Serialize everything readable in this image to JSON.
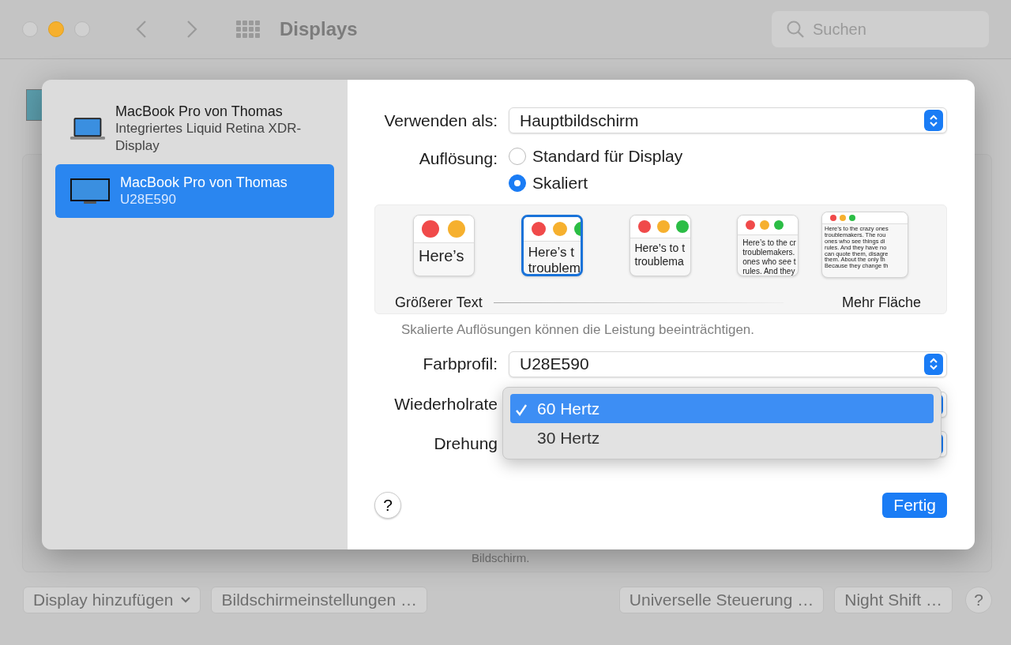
{
  "window": {
    "title": "Displays",
    "search": {
      "placeholder": "Suchen"
    }
  },
  "background": {
    "hidden_text": "Bildschirm.",
    "buttons": [
      {
        "label": "Display hinzufügen",
        "kind": "dropdown"
      },
      {
        "label": "Bildschirmeinstellungen …",
        "kind": "plain"
      },
      {
        "label": "Universelle Steuerung …",
        "kind": "plain"
      },
      {
        "label": "Night Shift …",
        "kind": "plain"
      }
    ],
    "help": "?"
  },
  "sheet": {
    "sidebar": {
      "items": [
        {
          "name": "MacBook Pro von Thomas",
          "detail": "Integriertes Liquid Retina XDR-Display",
          "kind": "laptop",
          "selected": false
        },
        {
          "name": "MacBook Pro von Thomas",
          "detail": "U28E590",
          "kind": "monitor",
          "selected": true
        }
      ]
    },
    "use_as": {
      "label": "Verwenden als:",
      "value": "Hauptbildschirm"
    },
    "resolution": {
      "label": "Auflösung:",
      "options": [
        {
          "label": "Standard für Display",
          "selected": false
        },
        {
          "label": "Skaliert",
          "selected": true
        }
      ]
    },
    "scaling": {
      "previews": [
        {
          "lines": [
            "Here’s"
          ],
          "selected": false
        },
        {
          "lines": [
            "Here’s t",
            "troublem"
          ],
          "selected": true
        },
        {
          "lines": [
            "Here’s to t",
            "troublema"
          ],
          "selected": false
        },
        {
          "lines": [
            "Here’s to the cr",
            "troublemakers.",
            "ones who see t",
            "rules. And they"
          ],
          "selected": false
        },
        {
          "lines": [
            "Here’s to the crazy ones",
            "troublemakers. The rou",
            "ones who see things di",
            "rules. And they have no",
            "can quote them, disagre",
            "them. About the only th",
            "Because they change th"
          ],
          "selected": false
        }
      ],
      "left_label": "Größerer Text",
      "right_label": "Mehr Fläche"
    },
    "note": "Skalierte Auflösungen können die Leistung beeinträchtigen.",
    "color_profile": {
      "label": "Farbprofil:",
      "value": "U28E590"
    },
    "refresh_rate": {
      "label": "Wiederholrate"
    },
    "rotation": {
      "label": "Drehung"
    },
    "menu": {
      "items": [
        {
          "label": "60 Hertz",
          "selected": true
        },
        {
          "label": "30 Hertz",
          "selected": false
        }
      ]
    },
    "help": "?",
    "done": "Fertig"
  }
}
